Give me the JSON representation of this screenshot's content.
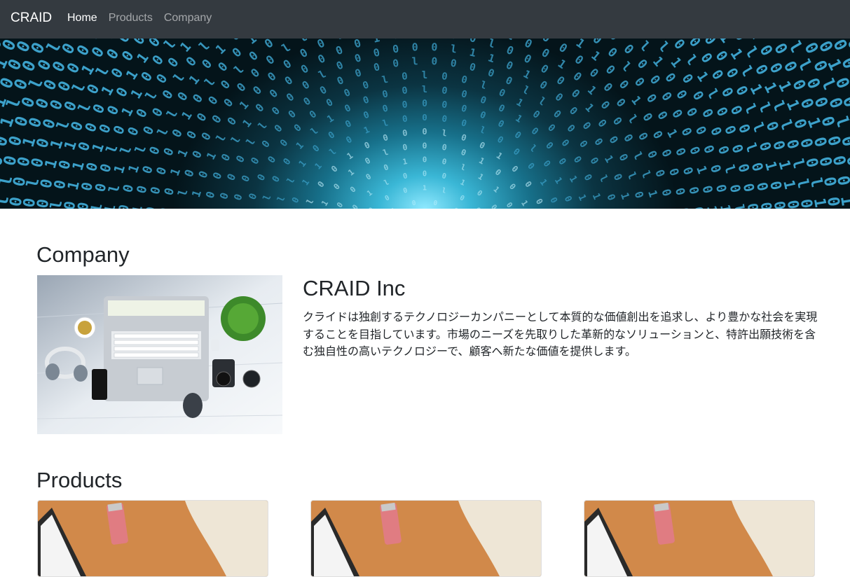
{
  "navbar": {
    "brand": "CRAID",
    "links": [
      {
        "label": "Home",
        "active": true
      },
      {
        "label": "Products",
        "active": false
      },
      {
        "label": "Company",
        "active": false
      }
    ],
    "background": "#343a40"
  },
  "hero": {
    "image": "binary-code-tunnel",
    "accent": "#3ab7d6"
  },
  "company_section": {
    "heading": "Company",
    "image": "workspace-laptop-desk",
    "name": "CRAID Inc",
    "description": "クライドは独創するテクノロジーカンパニーとして本質的な価値創出を追求し、より豊かな社会を実現することを目指しています。市場のニーズを先取りした革新的なソリューションと、特許出願技術を含む独自性の高いテクノロジーで、顧客へ新たな価値を提供します。"
  },
  "products_section": {
    "heading": "Products",
    "cards": [
      {
        "image": "laptop-on-wooden-table"
      },
      {
        "image": "laptop-on-wooden-table"
      },
      {
        "image": "laptop-on-wooden-table"
      }
    ]
  }
}
